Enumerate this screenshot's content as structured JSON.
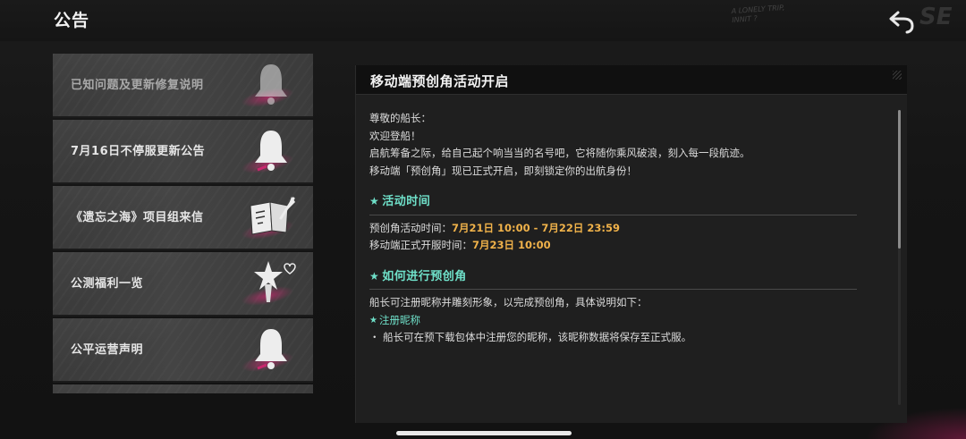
{
  "header": {
    "title": "公告",
    "deco_text_line1": "A LONELY TRIP,",
    "deco_text_line2": "INNIT ?",
    "deco_big": "SE"
  },
  "sidebar": {
    "items": [
      {
        "label": "已知问题及更新修复说明",
        "icon": "bell-icon",
        "active": false
      },
      {
        "label": "7月16日不停服更新公告",
        "icon": "bell-icon",
        "active": false
      },
      {
        "label": "《遗忘之海》项目组来信",
        "icon": "letter-quill-icon",
        "active": false
      },
      {
        "label": "公测福利一览",
        "icon": "gift-star-icon",
        "active": false
      },
      {
        "label": "公平运营声明",
        "icon": "bell-icon",
        "active": false
      }
    ]
  },
  "article": {
    "title": "移动端预创角活动开启",
    "greeting": "尊敬的船长：",
    "welcome": "欢迎登船！",
    "intro1": "启航筹备之际，给自己起个响当当的名号吧，它将随你乘风破浪，刻入每一段航迹。",
    "intro2": "移动端「预创角」现已正式开启，即刻锁定你的出航身份！",
    "section1": {
      "title": "活动时间",
      "row1_label": "预创角活动时间：",
      "row1_value": "7月21日 10:00 - 7月22日 23:59",
      "row2_label": "移动端正式开服时间：",
      "row2_value": "7月23日 10:00"
    },
    "section2": {
      "title": "如何进行预创角",
      "desc": "船长可注册昵称并雕刻形象，以完成预创角，具体说明如下：",
      "sub_title": "注册昵称",
      "bullet": "・ 船长可在预下载包体中注册您的昵称，该昵称数据将保存至正式服。"
    },
    "scroll_position": 0
  },
  "colors": {
    "accent_teal": "#6fe0c9",
    "highlight_orange": "#f0b24a",
    "brand_pink": "#c8286e"
  }
}
